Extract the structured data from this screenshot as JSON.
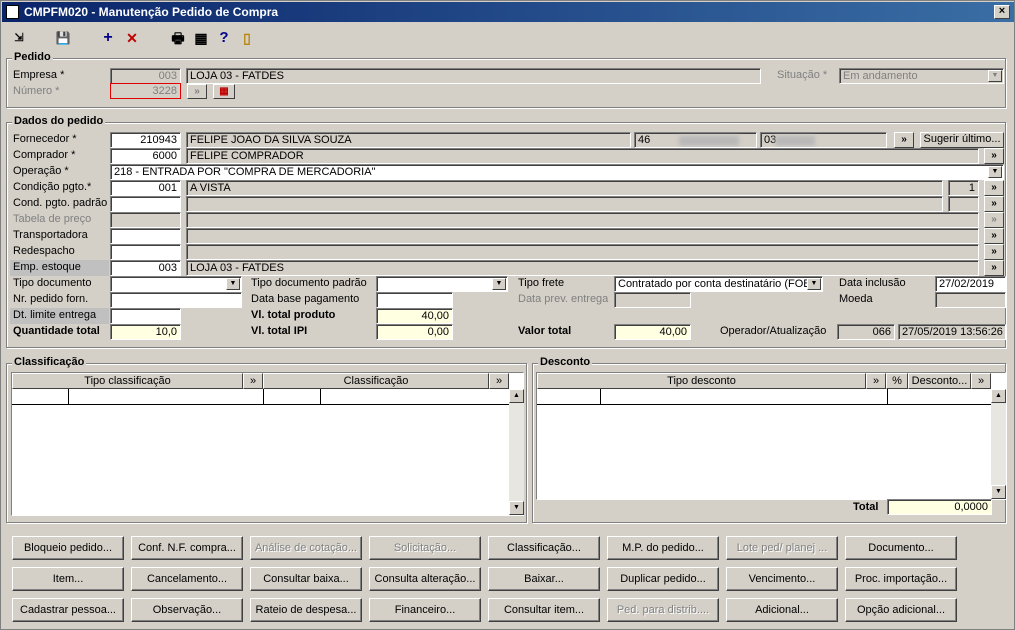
{
  "window": {
    "title": "CMPFM020 - Manutenção Pedido de Compra",
    "close": "×"
  },
  "toolbar": {
    "exit": "⇲",
    "save": "💾",
    "add": "+",
    "delete": "✕",
    "print": "🖶",
    "grid": "▦",
    "help": "?",
    "door": "▯"
  },
  "pedido": {
    "group": "Pedido",
    "empresa_label": "Empresa *",
    "empresa_code": "003",
    "empresa_name": "LOJA 03 - FATDES",
    "situacao_label": "Situação *",
    "situacao_value": "Em andamento",
    "numero_label": "Número *",
    "numero_value": "3228"
  },
  "dados": {
    "group": "Dados do pedido",
    "fornecedor_label": "Fornecedor *",
    "fornecedor_code": "210943",
    "fornecedor_name": "FELIPE JOAO DA SILVA SOUZA",
    "fornecedor_doc1": "46",
    "fornecedor_doc2": "03",
    "sugerir": "Sugerir último...",
    "comprador_label": "Comprador *",
    "comprador_code": "6000",
    "comprador_name": "FELIPE COMPRADOR",
    "operacao_label": "Operação *",
    "operacao_value": "218 - ENTRADA POR \"COMPRA DE MERCADORIA\"",
    "condicao_label": "Condição pgto.*",
    "condicao_code": "001",
    "condicao_name": "A VISTA",
    "condicao_count": "1",
    "condpadrao_label": "Cond. pgto. padrão",
    "tabela_label": "Tabela de preço",
    "transportadora_label": "Transportadora",
    "redespacho_label": "Redespacho",
    "empestoque_label": "Emp. estoque",
    "empestoque_code": "003",
    "empestoque_name": "LOJA 03 - FATDES",
    "tipodoc_label": "Tipo documento",
    "tipodocpadrao_label": "Tipo documento padrão",
    "tipofrete_label": "Tipo frete",
    "tipofrete_value": "Contratado por conta destinatário (FOB)",
    "datainclusao_label": "Data inclusão",
    "datainclusao_value": "27/02/2019",
    "nrpedido_label": "Nr. pedido forn.",
    "database_label": "Data base pagamento",
    "dataprev_label": "Data prev. entrega",
    "moeda_label": "Moeda",
    "dtlimite_label": "Dt. limite entrega",
    "vltotalprod_label": "Vl. total produto",
    "vltotalprod_value": "40,00",
    "qtdtotal_label": "Quantidade total",
    "qtdtotal_value": "10,0",
    "vltotalipi_label": "Vl. total IPI",
    "vltotalipi_value": "0,00",
    "valortotal_label": "Valor total",
    "valortotal_value": "40,00",
    "operador_label": "Operador/Atualização",
    "operador_code": "066",
    "operador_date": "27/05/2019 13:56:26"
  },
  "classificacao": {
    "group": "Classificação",
    "col1": "Tipo classificação",
    "col2": "Classificação",
    "more": "»"
  },
  "desconto": {
    "group": "Desconto",
    "col1": "Tipo desconto",
    "col2": "%",
    "col3": "Desconto...",
    "more": "»",
    "total_label": "Total",
    "total_value": "0,0000"
  },
  "more": "»",
  "buttons": [
    [
      "Bloqueio pedido...",
      "Conf. N.F. compra...",
      "Análise de cotação...",
      "Solicitação...",
      "Classificação...",
      "M.P. do pedido...",
      "Lote ped/ planej ...",
      "Documento..."
    ],
    [
      "Item...",
      "Cancelamento...",
      "Consultar baixa...",
      "Consulta alteração...",
      "Baixar...",
      "Duplicar pedido...",
      "Vencimento...",
      "Proc. importação..."
    ],
    [
      "Cadastrar pessoa...",
      "Observação...",
      "Rateio de despesa...",
      "Financeiro...",
      "Consultar item...",
      "Ped. para distrib....",
      "Adicional...",
      "Opção adicional..."
    ]
  ]
}
